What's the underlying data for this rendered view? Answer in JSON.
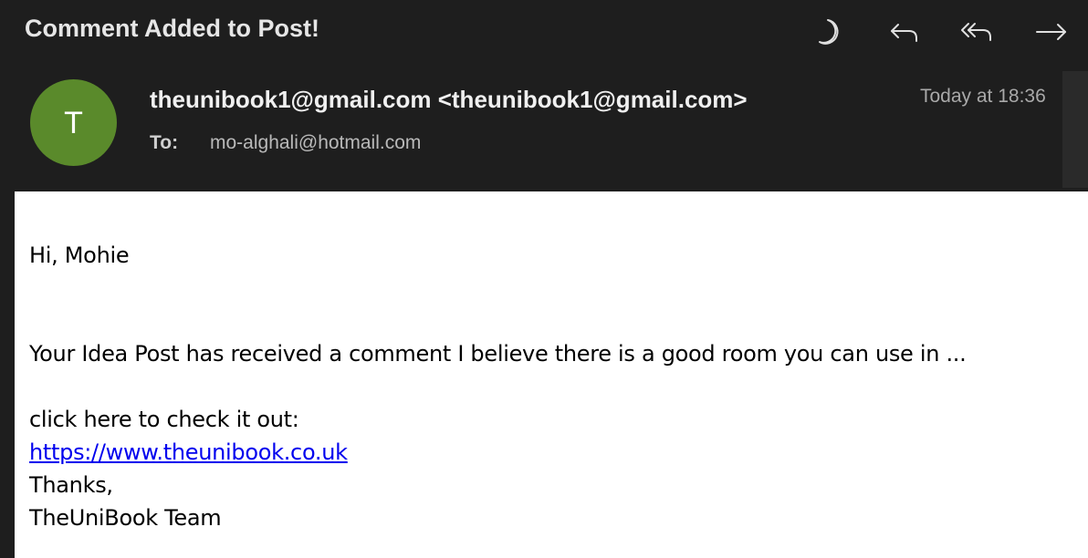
{
  "message": {
    "subject": "Comment Added to Post!",
    "avatar_letter": "T",
    "sender": "theunibook1@gmail.com <theunibook1@gmail.com>",
    "to_label": "To:",
    "to_value": "mo-alghali@hotmail.com",
    "date": "Today at 18:36"
  },
  "toolbar": {
    "icons": [
      "moon-icon",
      "reply-icon",
      "reply-all-icon",
      "forward-icon"
    ]
  },
  "body": {
    "greeting": "Hi, Mohie",
    "paragraph": "Your Idea Post has received a comment I believe there is a good room you can use in ...",
    "cta": "click here to check it out:",
    "link": "https://www.theunibook.co.uk",
    "thanks": "Thanks,",
    "signature": "TheUniBook Team"
  },
  "colors": {
    "header_bg": "#1e1e1e",
    "avatar_bg": "#5a8a2b",
    "link": "#0000ee",
    "body_bg": "#ffffff"
  }
}
